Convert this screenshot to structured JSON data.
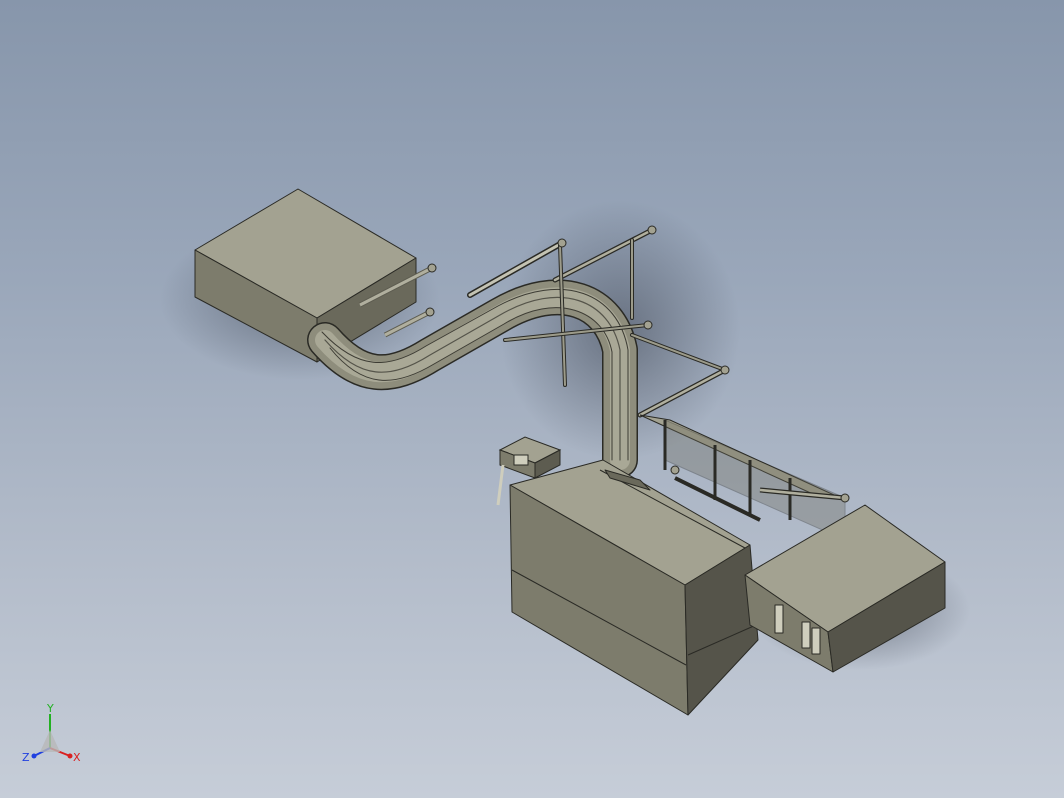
{
  "viewport": {
    "background_top": "#8796ab",
    "background_bottom": "#c6cdd8"
  },
  "model": {
    "body_color": "#7d7c6c",
    "edge_color": "#2a2a25",
    "highlight_color": "#a3a291"
  },
  "triad": {
    "x_label": "X",
    "y_label": "Y",
    "z_label": "Z",
    "x_color": "#d92020",
    "y_color": "#22b022",
    "z_color": "#2040e0"
  }
}
